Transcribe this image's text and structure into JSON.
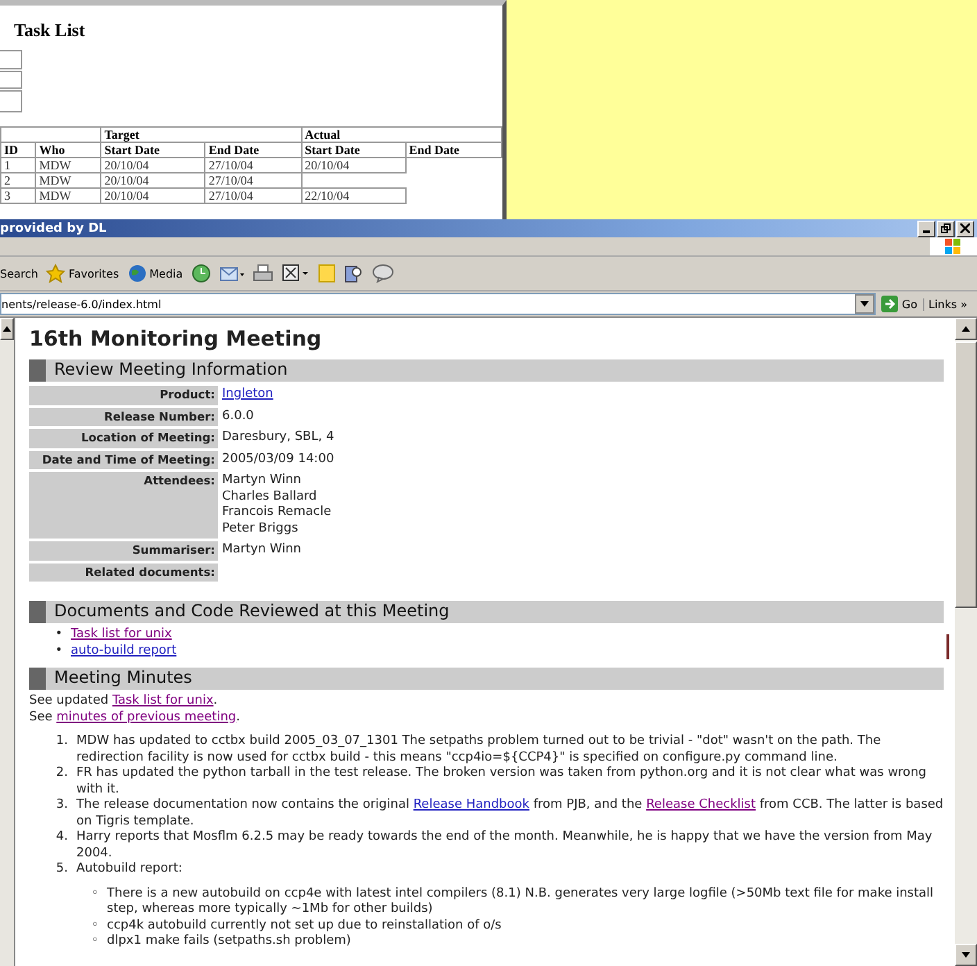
{
  "task_list_window": {
    "title": "Task List",
    "group_headers": [
      "Target",
      "Actual"
    ],
    "columns": [
      "ID",
      "Who",
      "Start Date",
      "End Date",
      "Start Date",
      "End Date"
    ],
    "rows": [
      {
        "cells": [
          "1",
          "MDW",
          "20/10/04",
          "27/10/04",
          "20/10/04"
        ]
      },
      {
        "cells": [
          "2",
          "MDW",
          "20/10/04",
          "27/10/04"
        ]
      },
      {
        "cells": [
          "3",
          "MDW",
          "20/10/04",
          "27/10/04",
          "22/10/04"
        ]
      }
    ]
  },
  "browser": {
    "title": "provided by DL",
    "toolbar": [
      {
        "kind": "search",
        "label": "Search"
      },
      {
        "kind": "favorites",
        "label": "Favorites"
      },
      {
        "kind": "media",
        "label": "Media"
      },
      {
        "kind": "history"
      },
      {
        "kind": "mail"
      },
      {
        "kind": "print"
      },
      {
        "kind": "edit"
      },
      {
        "kind": "notes"
      },
      {
        "kind": "research"
      },
      {
        "kind": "messenger"
      }
    ],
    "address": "nents/release-6.0/index.html",
    "go": "Go",
    "links": "Links »"
  },
  "page": {
    "title": "16th Monitoring Meeting",
    "info_section": {
      "title": "Review Meeting Information",
      "rows": [
        {
          "label": "Product:",
          "values": [
            "Ingleton"
          ],
          "kind": "link"
        },
        {
          "label": "Release Number:",
          "values": [
            "6.0.0"
          ],
          "kind": "text"
        },
        {
          "label": "Location of Meeting:",
          "values": [
            "Daresbury, SBL, 4"
          ],
          "kind": "text"
        },
        {
          "label": "Date and Time of Meeting:",
          "values": [
            "2005/03/09 14:00"
          ],
          "kind": "text"
        },
        {
          "label": "Attendees:",
          "values": [
            "Martyn Winn",
            "Charles Ballard",
            "Francois Remacle",
            "Peter Briggs"
          ],
          "kind": "text"
        },
        {
          "label": "Summariser:",
          "values": [
            "Martyn Winn"
          ],
          "kind": "text"
        },
        {
          "label": "Related documents:",
          "values": []
        }
      ]
    },
    "documents_section": {
      "title": "Documents and Code Reviewed at this Meeting",
      "links": [
        {
          "marker": "•",
          "text": "Task list for unix",
          "visited": true
        },
        {
          "marker": "•",
          "text": "auto-build report",
          "visited": false
        }
      ]
    },
    "minutes_section": {
      "title": "Meeting Minutes",
      "intro": [
        [
          {
            "text": "See updated "
          },
          {
            "link": "Task list for unix",
            "visited": true
          },
          {
            "text": "."
          }
        ],
        [
          {
            "text": "See "
          },
          {
            "link": "minutes of previous meeting",
            "visited": true
          },
          {
            "text": "."
          }
        ]
      ],
      "items": [
        {
          "marker": "1.",
          "parts": [
            {
              "text": "MDW has updated to cctbx build 2005_03_07_1301 The setpaths problem turned out to be trivial - \"dot\" wasn't on the path. The redirection facility is now used for cctbx build - this means \"ccp4io=${CCP4}\" is specified on configure.py command line."
            }
          ]
        },
        {
          "marker": "2.",
          "parts": [
            {
              "text": "FR has updated the python tarball in the test release. The broken version was taken from python.org and it is not clear what was wrong with it."
            }
          ]
        },
        {
          "marker": "3.",
          "parts": [
            {
              "text": "The release documentation now contains the original "
            },
            {
              "link": "Release Handbook",
              "visited": false
            },
            {
              "text": " from PJB, and the "
            },
            {
              "link": "Release Checklist",
              "visited": true
            },
            {
              "text": " from CCB. The latter is based on Tigris template."
            }
          ]
        },
        {
          "marker": "4.",
          "parts": [
            {
              "text": "Harry reports that Mosflm 6.2.5 may be ready towards the end of the month. Meanwhile, he is happy that we have the version from May 2004."
            }
          ]
        },
        {
          "marker": "5.",
          "parts": [
            {
              "text": "Autobuild report:"
            }
          ],
          "subitems": [
            {
              "marker": "◦",
              "text": "There is a new autobuild on ccp4e with latest intel compilers (8.1) N.B. generates very large logfile (>50Mb text file for make install step, whereas more typically ~1Mb for other builds)"
            },
            {
              "marker": "◦",
              "text": "ccp4k autobuild currently not set up due to reinstallation of o/s"
            },
            {
              "marker": "◦",
              "text": "dlpx1 make fails (setpaths.sh problem)"
            }
          ]
        }
      ]
    }
  }
}
